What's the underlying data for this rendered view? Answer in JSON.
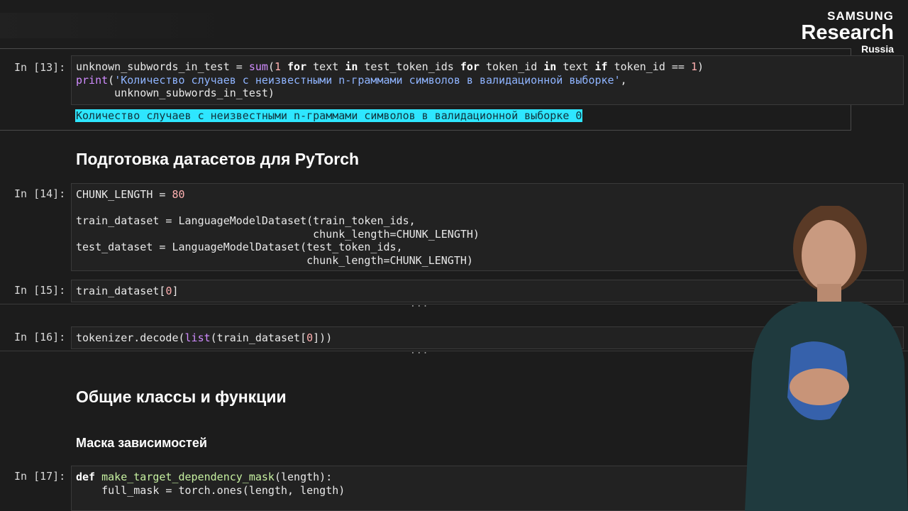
{
  "branding": {
    "line1": "SAMSUNG",
    "line2": "Research",
    "line3": "Russia"
  },
  "cells": {
    "c13": {
      "prompt": "In [13]:",
      "output": "Количество случаев с неизвестными n-граммами символов в валидационной выборке 0"
    },
    "c14": {
      "prompt": "In [14]:"
    },
    "c15": {
      "prompt": "In [15]:",
      "code": "train_dataset[0]"
    },
    "c16": {
      "prompt": "In [16]:"
    },
    "c17": {
      "prompt": "In [17]:"
    }
  },
  "headings": {
    "h1": "Подготовка датасетов для PyTorch",
    "h2": "Общие классы и функции",
    "h3": "Маска зависимостей"
  },
  "collapsed_marker": "...",
  "colors": {
    "highlight": "#2ee6ff",
    "background": "#1c1c1c"
  }
}
